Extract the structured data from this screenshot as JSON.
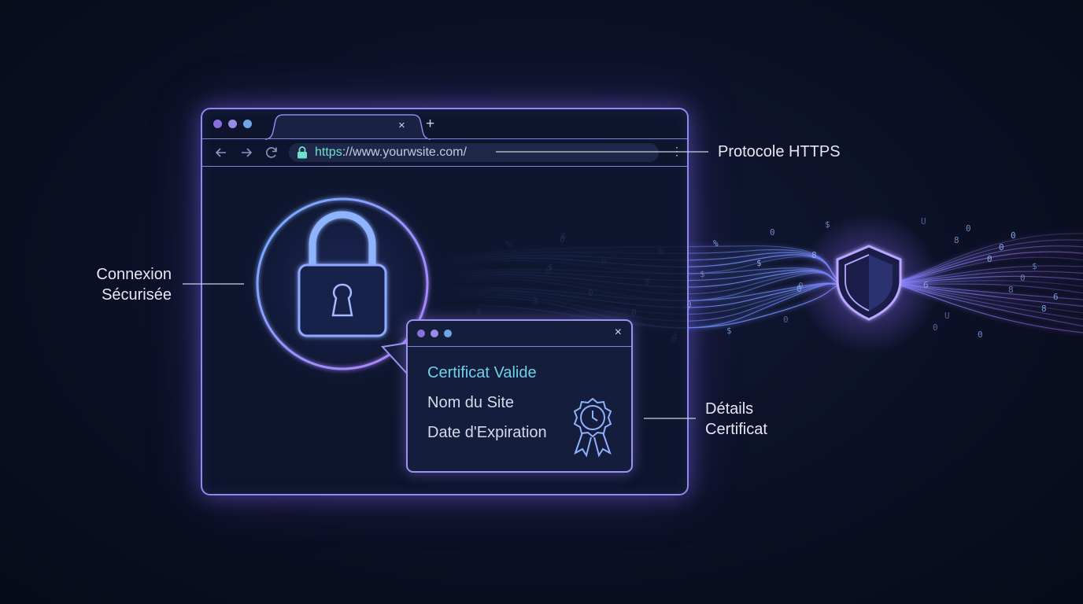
{
  "browser": {
    "url_scheme": "https",
    "url_rest": "://www.yourwsite.com/",
    "tab_close": "×",
    "tab_add": "+",
    "kebab": "⋮"
  },
  "popup": {
    "close": "×",
    "title": "Certificat Valide",
    "name": "Nom du Site",
    "expiration": "Date d'Expiration"
  },
  "labels": {
    "https": "Protocole HTTPS",
    "connexion_line1": "Connexion",
    "connexion_line2": "Sécurisée",
    "details_line1": "Détails",
    "details_line2": "Certificat"
  },
  "data_stream_chars": [
    "U",
    "%",
    "$",
    "8",
    "0",
    "§",
    "8",
    "$",
    "0",
    "8",
    "%",
    "6",
    "0",
    "8",
    "0",
    "0",
    "0",
    "8",
    "0",
    "3",
    "8",
    "0",
    "%",
    "$",
    "6",
    "0",
    "$",
    "0",
    "8",
    "0",
    "U",
    "6",
    "%",
    "$",
    "0",
    "8",
    "0",
    "0",
    "8",
    "6",
    "0",
    "$",
    "0"
  ],
  "icons": [
    "back-arrow-icon",
    "forward-arrow-icon",
    "reload-icon",
    "padlock-icon",
    "certificate-badge-icon",
    "shield-icon"
  ],
  "colors": {
    "accent_purple": "#9e92f0",
    "accent_blue": "#6fa4e6",
    "https_green": "#6fe2cf",
    "cert_title": "#6ed0ea"
  }
}
